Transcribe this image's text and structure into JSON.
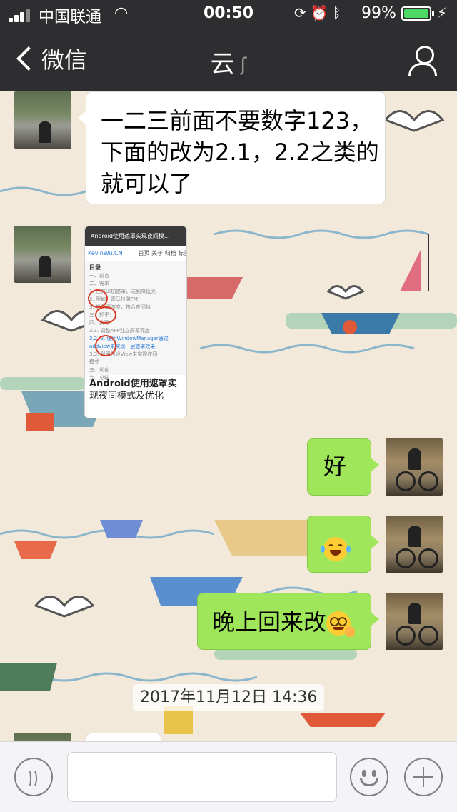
{
  "status_bar": {
    "carrier": "中国联通",
    "time": "00:50",
    "battery_percent": "99%",
    "battery_level": 0.99,
    "icons": [
      "signal-icon",
      "wifi-icon",
      "rotation-lock-icon",
      "alarm-icon",
      "bluetooth-icon",
      "charging-icon"
    ]
  },
  "nav": {
    "back_label": "微信",
    "title": "云",
    "title_icon": "ear-icon",
    "right_icon": "profile-icon"
  },
  "messages": [
    {
      "side": "left",
      "type": "text",
      "lines": [
        "一二三前面不要数字123，",
        "下面的改为2.1，2.2之类的",
        "就可以了"
      ]
    },
    {
      "side": "left",
      "type": "image",
      "image": {
        "header": "Android使用遮罩实现夜间模...",
        "site": "KevinWu.CN",
        "tabs": "首页 关于 归档 标签",
        "toc_title": "目录",
        "toc_lines": [
          "一、前言",
          "二、需求",
          "1. 已有UI加遮罩，达到降低亮",
          "2. 例如：喜马拉雅FM：",
          "3. 颜色调浓度，符合夜间特",
          "三、知乎：",
          "四、实现",
          "3.1. 调整APP独立屏幕亮度",
          "3.2. 2. 使用WindowManager通过",
          "addview来实现一层遮罩效果",
          "3.3. 利用预设View来实现夜间",
          "模式",
          "五、优化",
          "六、总结"
        ],
        "article_title": "Android使用遮罩实",
        "article_title_2": "现夜间模式及优化"
      }
    },
    {
      "side": "right",
      "type": "text",
      "text": "好"
    },
    {
      "side": "right",
      "type": "emoji",
      "emoji": "tears-of-joy-emoji"
    },
    {
      "side": "right",
      "type": "text",
      "text": "晚上回来改",
      "trailing_emoji": "face-with-monocle-emoji"
    }
  ],
  "timestamp": "2017年11月12日 14:36",
  "input_bar": {
    "voice_icon": "voice-icon",
    "input_value": "",
    "emoji_icon": "smiley-icon",
    "more_icon": "plus-icon"
  }
}
